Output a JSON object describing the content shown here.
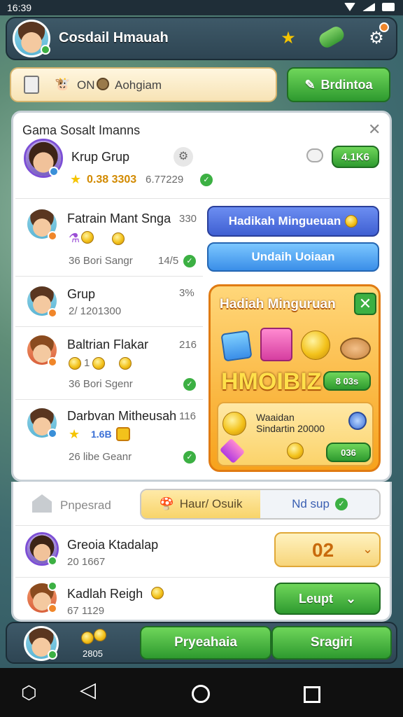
{
  "status_bar": {
    "time": "16:39"
  },
  "header": {
    "title": "Cosdail Hmauah"
  },
  "search": {
    "text": "ON",
    "value": "Aohgiam",
    "action": "Brdintoa"
  },
  "panel": {
    "title": "Gama Sosalt Imanns",
    "group": {
      "name": "Krup Grup",
      "stats": "0.38 3303",
      "amount": "6.77229",
      "button": "4.1K6"
    },
    "rows": [
      {
        "name": "Fatrain Mant Snga",
        "count": "330",
        "sub": "36 Bori Sangr",
        "sub2": "14/5"
      },
      {
        "name": "Grup",
        "count": "3%",
        "sub": "2/ 1201300"
      },
      {
        "name": "Baltrian Flakar",
        "count": "216",
        "sub": "36 Bori Sgenr",
        "coins": "1"
      },
      {
        "name": "Darbvan Mitheusah",
        "count": "116",
        "sub": "26 libe Geanr",
        "badge": "1.6B"
      }
    ],
    "buttons": {
      "weekly": "Hadikah Mingueuan",
      "undo": "Undaih Uoiaan"
    }
  },
  "promo": {
    "title": "Hadiah Minguruan",
    "big": "HMOIBIZ",
    "pill1": "8 03s",
    "text1": "Waaidan",
    "text2": "Sindartin 20000",
    "pill2": "036"
  },
  "tabs": {
    "home": "Pnpesrad",
    "left": "Haur/ Osuik",
    "right": "Nd sup"
  },
  "list": [
    {
      "name": "Greoia Ktadalap",
      "sub": "20 1667",
      "value": "02"
    },
    {
      "name": "Kadlah Reigh",
      "sub": "67 1129",
      "button": "Leupt"
    }
  ],
  "footer": {
    "coins": "2805",
    "btn1": "Pryeahaia",
    "btn2": "Sragiri"
  },
  "colors": {
    "green": "#3cb043",
    "blue": "#3f5fd2",
    "orange": "#f7a21c",
    "gold": "#f3c21b"
  }
}
